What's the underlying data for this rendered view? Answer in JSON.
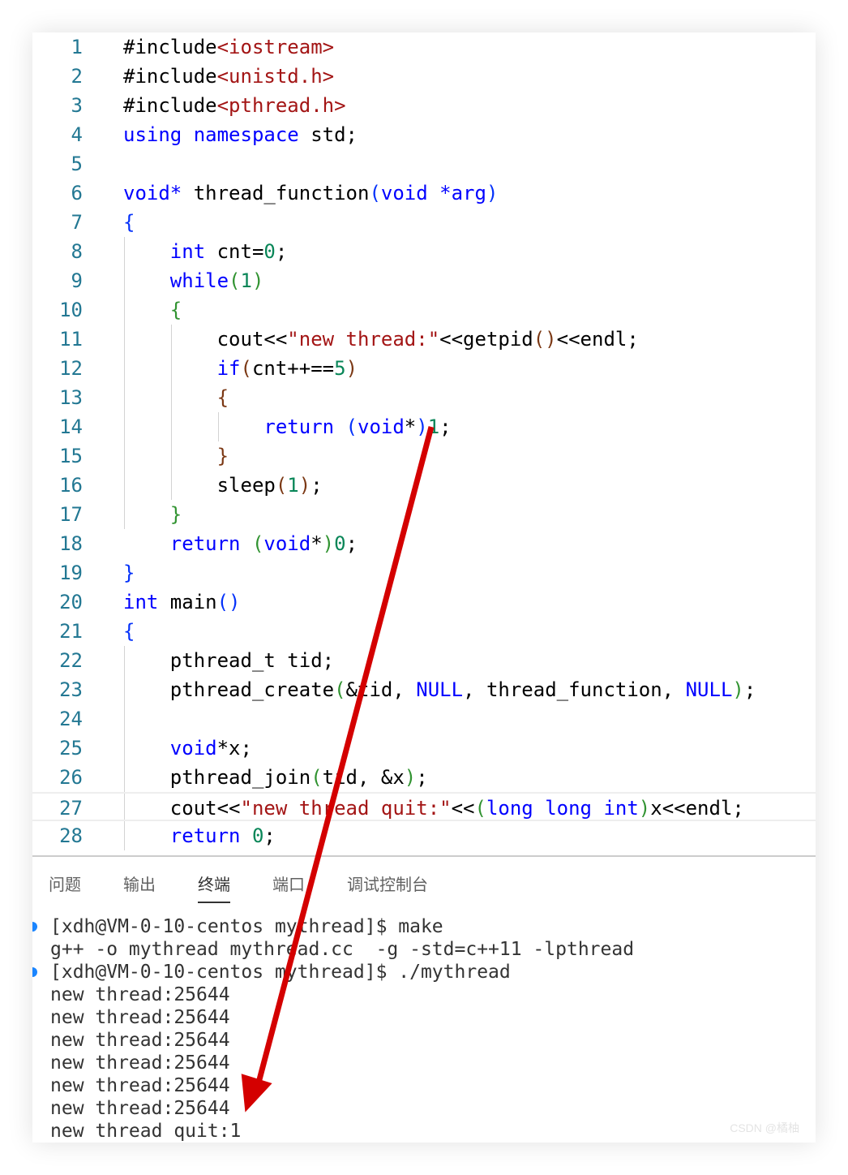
{
  "editor": {
    "current_line": 27,
    "lines": [
      [
        [
          "#include",
          "t"
        ],
        [
          "<iostream>",
          "s"
        ]
      ],
      [
        [
          "#include",
          "t"
        ],
        [
          "<unistd.h>",
          "s"
        ]
      ],
      [
        [
          "#include",
          "t"
        ],
        [
          "<pthread.h>",
          "s"
        ]
      ],
      [
        [
          "using namespace",
          "k"
        ],
        [
          " std;",
          "t"
        ]
      ],
      [],
      [
        [
          "void*",
          "k"
        ],
        [
          " thread_function",
          "t"
        ],
        [
          "(",
          "b1"
        ],
        [
          "void *arg",
          "k"
        ],
        [
          ")",
          "b1"
        ]
      ],
      [
        [
          "{",
          "b1"
        ]
      ],
      [
        [
          "    ",
          "t"
        ],
        [
          "int",
          "k"
        ],
        [
          " cnt=",
          "t"
        ],
        [
          "0",
          "n"
        ],
        [
          ";",
          "t"
        ]
      ],
      [
        [
          "    ",
          "t"
        ],
        [
          "while",
          "k"
        ],
        [
          "(",
          "b2"
        ],
        [
          "1",
          "n"
        ],
        [
          ")",
          "b2"
        ]
      ],
      [
        [
          "    ",
          "t"
        ],
        [
          "{",
          "b2"
        ]
      ],
      [
        [
          "        cout<<",
          "t"
        ],
        [
          "\"new thread:\"",
          "s"
        ],
        [
          "<<getpid",
          "t"
        ],
        [
          "()",
          "b3"
        ],
        [
          "<<endl;",
          "t"
        ]
      ],
      [
        [
          "        ",
          "t"
        ],
        [
          "if",
          "k"
        ],
        [
          "(",
          "b3"
        ],
        [
          "cnt++==",
          "t"
        ],
        [
          "5",
          "n"
        ],
        [
          ")",
          "b3"
        ]
      ],
      [
        [
          "        ",
          "t"
        ],
        [
          "{",
          "b3"
        ]
      ],
      [
        [
          "            ",
          "t"
        ],
        [
          "return",
          "k"
        ],
        [
          " (",
          "b1"
        ],
        [
          "void",
          "k"
        ],
        [
          "*",
          "t"
        ],
        [
          ")",
          "b1"
        ],
        [
          "1",
          "n"
        ],
        [
          ";",
          "t"
        ]
      ],
      [
        [
          "        ",
          "t"
        ],
        [
          "}",
          "b3"
        ]
      ],
      [
        [
          "        sleep",
          "t"
        ],
        [
          "(",
          "b3"
        ],
        [
          "1",
          "n"
        ],
        [
          ")",
          "b3"
        ],
        [
          ";",
          "t"
        ]
      ],
      [
        [
          "    ",
          "t"
        ],
        [
          "}",
          "b2"
        ]
      ],
      [
        [
          "    ",
          "t"
        ],
        [
          "return",
          "k"
        ],
        [
          " (",
          "b2"
        ],
        [
          "void",
          "k"
        ],
        [
          "*",
          "t"
        ],
        [
          ")",
          "b2"
        ],
        [
          "0",
          "n"
        ],
        [
          ";",
          "t"
        ]
      ],
      [
        [
          "}",
          "b1"
        ]
      ],
      [
        [
          "int",
          "k"
        ],
        [
          " main",
          "t"
        ],
        [
          "()",
          "b1"
        ]
      ],
      [
        [
          "{",
          "b1"
        ]
      ],
      [
        [
          "    pthread_t tid;",
          "t"
        ]
      ],
      [
        [
          "    pthread_create",
          "t"
        ],
        [
          "(",
          "b2"
        ],
        [
          "&tid, ",
          "t"
        ],
        [
          "NULL",
          "k"
        ],
        [
          ", thread_function, ",
          "t"
        ],
        [
          "NULL",
          "k"
        ],
        [
          ")",
          "b2"
        ],
        [
          ";",
          "t"
        ]
      ],
      [],
      [
        [
          "    ",
          "t"
        ],
        [
          "void",
          "k"
        ],
        [
          "*x;",
          "t"
        ]
      ],
      [
        [
          "    pthread_join",
          "t"
        ],
        [
          "(",
          "b2"
        ],
        [
          "tid, &x",
          "t"
        ],
        [
          ")",
          "b2"
        ],
        [
          ";",
          "t"
        ]
      ],
      [
        [
          "    cout<<",
          "t"
        ],
        [
          "\"new thread quit:\"",
          "s"
        ],
        [
          "<<",
          "t"
        ],
        [
          "(",
          "b2"
        ],
        [
          "long long int",
          "k"
        ],
        [
          ")",
          "b2"
        ],
        [
          "x<<endl;",
          "t"
        ]
      ],
      [
        [
          "    ",
          "t"
        ],
        [
          "return",
          "k"
        ],
        [
          " ",
          "t"
        ],
        [
          "0",
          "n"
        ],
        [
          ";",
          "t"
        ]
      ]
    ]
  },
  "panel": {
    "tabs": [
      "问题",
      "输出",
      "终端",
      "端口",
      "调试控制台"
    ],
    "active_tab": "终端"
  },
  "terminal": {
    "lines": [
      {
        "text": "[xdh@VM-0-10-centos mythread]$ make",
        "prompt": true
      },
      {
        "text": "g++ -o mythread mythread.cc  -g -std=c++11 -lpthread",
        "prompt": false
      },
      {
        "text": "[xdh@VM-0-10-centos mythread]$ ./mythread",
        "prompt": true
      },
      {
        "text": "new thread:25644",
        "prompt": false
      },
      {
        "text": "new thread:25644",
        "prompt": false
      },
      {
        "text": "new thread:25644",
        "prompt": false
      },
      {
        "text": "new thread:25644",
        "prompt": false
      },
      {
        "text": "new thread:25644",
        "prompt": false
      },
      {
        "text": "new thread:25644",
        "prompt": false
      },
      {
        "text": "new thread quit:1",
        "prompt": false
      }
    ]
  },
  "annotation": {
    "type": "red-arrow",
    "color": "#d40000"
  },
  "watermark": "CSDN @橘柚"
}
